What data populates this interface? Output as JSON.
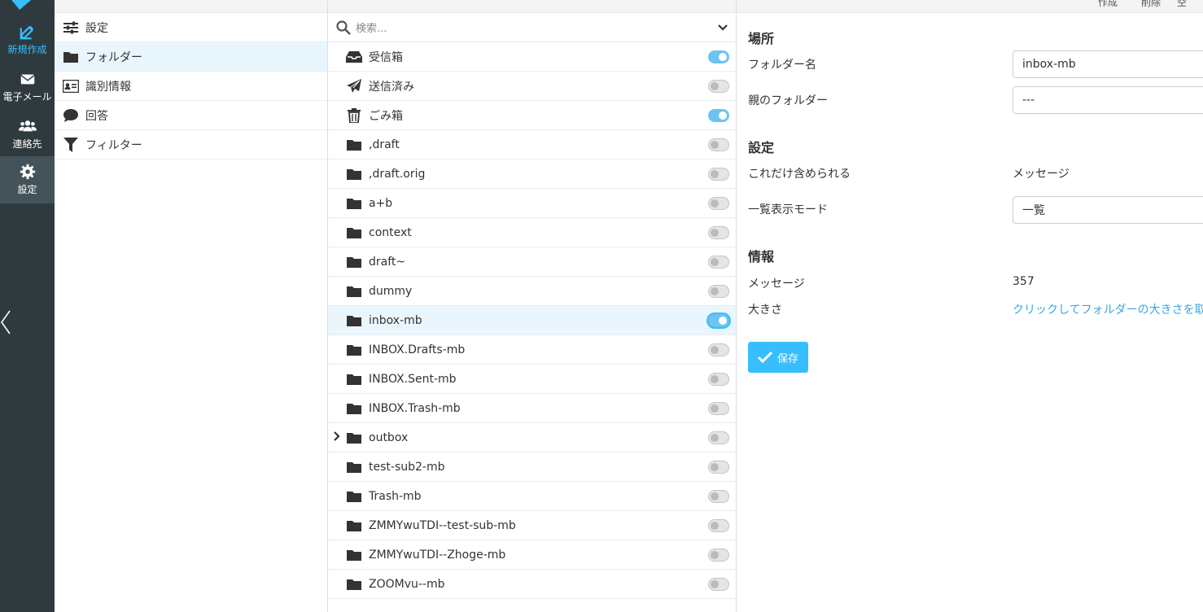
{
  "rail": {
    "items": [
      {
        "label": "新規作成"
      },
      {
        "label": "電子メール"
      },
      {
        "label": "連絡先"
      },
      {
        "label": "設定"
      }
    ]
  },
  "settings_nav": {
    "items": [
      {
        "label": "設定",
        "icon": "sliders-icon"
      },
      {
        "label": "フォルダー",
        "icon": "folder-icon"
      },
      {
        "label": "識別情報",
        "icon": "id-card-icon"
      },
      {
        "label": "回答",
        "icon": "comment-icon"
      },
      {
        "label": "フィルター",
        "icon": "filter-icon"
      }
    ]
  },
  "folder_list": {
    "search_placeholder": "検索...",
    "folders": [
      {
        "name": "受信箱",
        "icon": "inbox-icon",
        "subscribed": true
      },
      {
        "name": "送信済み",
        "icon": "paper-plane-icon",
        "subscribed": false
      },
      {
        "name": "ごみ箱",
        "icon": "trash-icon",
        "subscribed": true
      },
      {
        "name": ",draft",
        "icon": "folder-icon",
        "subscribed": false
      },
      {
        "name": ",draft.orig",
        "icon": "folder-icon",
        "subscribed": false
      },
      {
        "name": "a+b",
        "icon": "folder-icon",
        "subscribed": false
      },
      {
        "name": "context",
        "icon": "folder-icon",
        "subscribed": false
      },
      {
        "name": "draft~",
        "icon": "folder-icon",
        "subscribed": false
      },
      {
        "name": "dummy",
        "icon": "folder-icon",
        "subscribed": false
      },
      {
        "name": "inbox-mb",
        "icon": "folder-icon",
        "subscribed": true,
        "selected": true
      },
      {
        "name": "INBOX.Drafts-mb",
        "icon": "folder-icon",
        "subscribed": false
      },
      {
        "name": "INBOX.Sent-mb",
        "icon": "folder-icon",
        "subscribed": false
      },
      {
        "name": "INBOX.Trash-mb",
        "icon": "folder-icon",
        "subscribed": false
      },
      {
        "name": "outbox",
        "icon": "folder-icon",
        "subscribed": false,
        "expandable": true
      },
      {
        "name": "test-sub2-mb",
        "icon": "folder-icon",
        "subscribed": false
      },
      {
        "name": "Trash-mb",
        "icon": "folder-icon",
        "subscribed": false
      },
      {
        "name": "ZMMYwuTDI--test-sub-mb",
        "icon": "folder-icon",
        "subscribed": false
      },
      {
        "name": "ZMMYwuTDI--Zhoge-mb",
        "icon": "folder-icon",
        "subscribed": false
      },
      {
        "name": "ZOOMvu--mb",
        "icon": "folder-icon",
        "subscribed": false
      }
    ]
  },
  "toolbar": {
    "create_label": "作成",
    "delete_label": "削除",
    "empty_label": "空"
  },
  "details": {
    "location_title": "場所",
    "folder_name_label": "フォルダー名",
    "folder_name_value": "inbox-mb",
    "parent_folder_label": "親のフォルダー",
    "parent_folder_value": "---",
    "settings_title": "設定",
    "contains_label": "これだけ含められる",
    "contains_value": "メッセージ",
    "list_mode_label": "一覧表示モード",
    "list_mode_value": "一覧",
    "info_title": "情報",
    "messages_label": "メッセージ",
    "messages_value": "357",
    "size_label": "大きさ",
    "size_link": "クリックしてフォルダーの大きさを取得",
    "save_label": "保存"
  },
  "colors": {
    "accent": "#37beff",
    "rail_bg": "#2f3a3f",
    "selected_bg": "#eaf6fd",
    "link": "#37a7e0"
  }
}
